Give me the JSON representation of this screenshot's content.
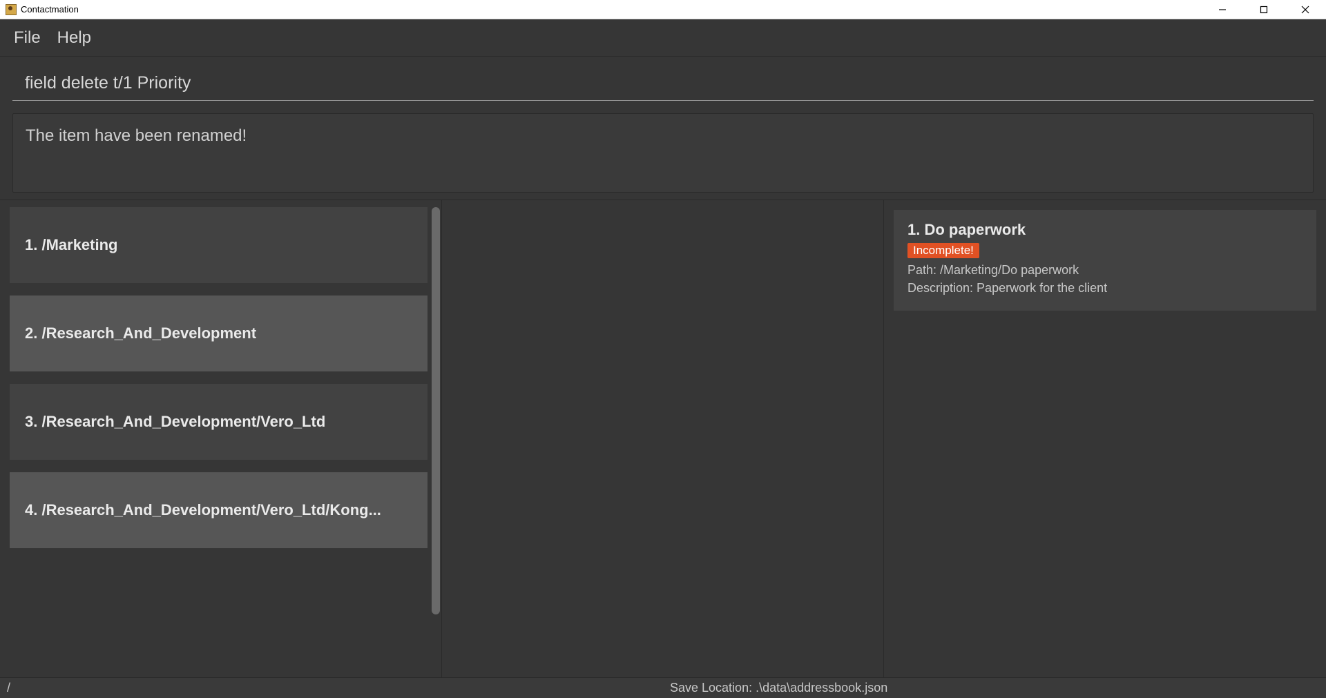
{
  "window": {
    "title": "Contactmation"
  },
  "menubar": {
    "file": "File",
    "help": "Help"
  },
  "command": {
    "value": "field delete t/1 Priority"
  },
  "message": {
    "text": "The item have been renamed!"
  },
  "leftList": {
    "items": [
      {
        "index": "1.",
        "label": "/Marketing",
        "alt": false
      },
      {
        "index": "2.",
        "label": "/Research_And_Development",
        "alt": true
      },
      {
        "index": "3.",
        "label": "/Research_And_Development/Vero_Ltd",
        "alt": false
      },
      {
        "index": "4.",
        "label": "/Research_And_Development/Vero_Ltd/Kong...",
        "alt": true
      }
    ]
  },
  "task": {
    "title": "1.  Do paperwork",
    "badge": "Incomplete!",
    "path_label": "Path: ",
    "path_value": "/Marketing/Do paperwork",
    "desc_label": "Description: ",
    "desc_value": "Paperwork for the client"
  },
  "statusbar": {
    "left": "/",
    "right": "Save Location: .\\data\\addressbook.json"
  }
}
